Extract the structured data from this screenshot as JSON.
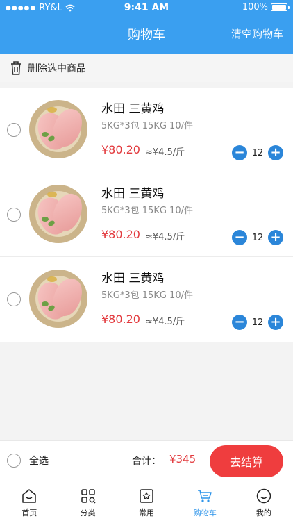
{
  "status_bar": {
    "carrier": "RY&L",
    "time": "9:41 AM",
    "battery": "100%"
  },
  "header": {
    "title": "购物车",
    "clear_label": "清空购物车"
  },
  "toolbar": {
    "delete_selected_label": "删除选中商品"
  },
  "cart": {
    "items": [
      {
        "name": "水田 三黄鸡",
        "spec": "5KG*3包 15KG 10/件",
        "price": "¥80.20",
        "unit_price": "≈¥4.5/斤",
        "quantity": "12"
      },
      {
        "name": "水田 三黄鸡",
        "spec": "5KG*3包 15KG 10/件",
        "price": "¥80.20",
        "unit_price": "≈¥4.5/斤",
        "quantity": "12"
      },
      {
        "name": "水田 三黄鸡",
        "spec": "5KG*3包 15KG 10/件",
        "price": "¥80.20",
        "unit_price": "≈¥4.5/斤",
        "quantity": "12"
      }
    ]
  },
  "footer": {
    "select_all_label": "全选",
    "total_label": "合计：",
    "total_value": "¥345",
    "checkout_label": "去结算"
  },
  "tabs": [
    {
      "label": "首页",
      "icon": "home-icon"
    },
    {
      "label": "分类",
      "icon": "category-icon"
    },
    {
      "label": "常用",
      "icon": "star-icon"
    },
    {
      "label": "购物车",
      "icon": "cart-icon",
      "active": true
    },
    {
      "label": "我的",
      "icon": "profile-icon"
    }
  ],
  "colors": {
    "brand": "#3a9ff0",
    "price": "#e2393d",
    "stepper": "#2b86d9",
    "checkout": "#ef3d3e"
  }
}
